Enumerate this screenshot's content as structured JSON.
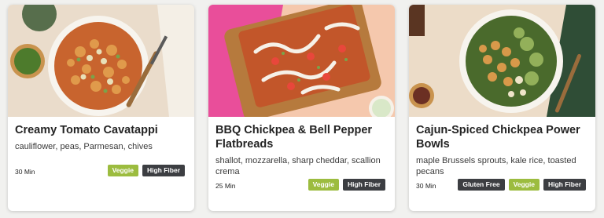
{
  "colors": {
    "page_background": "#f1f1ef",
    "card_background": "#ffffff",
    "veggie_tag": "#9cbc3f",
    "dark_tag": "#3c3e42"
  },
  "cards": [
    {
      "title": "Creamy Tomato Cavatappi",
      "description": "cauliflower, peas, Parmesan, chives",
      "time": "30 Min",
      "tags": [
        "Veggie",
        "High Fiber"
      ],
      "image_icon": "pasta-bowl-photo"
    },
    {
      "title": "BBQ Chickpea & Bell Pepper Flatbreads",
      "description": "shallot, mozzarella, sharp cheddar, scallion crema",
      "time": "25 Min",
      "tags": [
        "Veggie",
        "High Fiber"
      ],
      "image_icon": "flatbread-photo"
    },
    {
      "title": "Cajun-Spiced Chickpea Power Bowls",
      "description": "maple Brussels sprouts, kale rice, toasted pecans",
      "time": "30 Min",
      "tags": [
        "Gluten Free",
        "Veggie",
        "High Fiber"
      ],
      "image_icon": "chickpea-bowl-photo"
    }
  ]
}
